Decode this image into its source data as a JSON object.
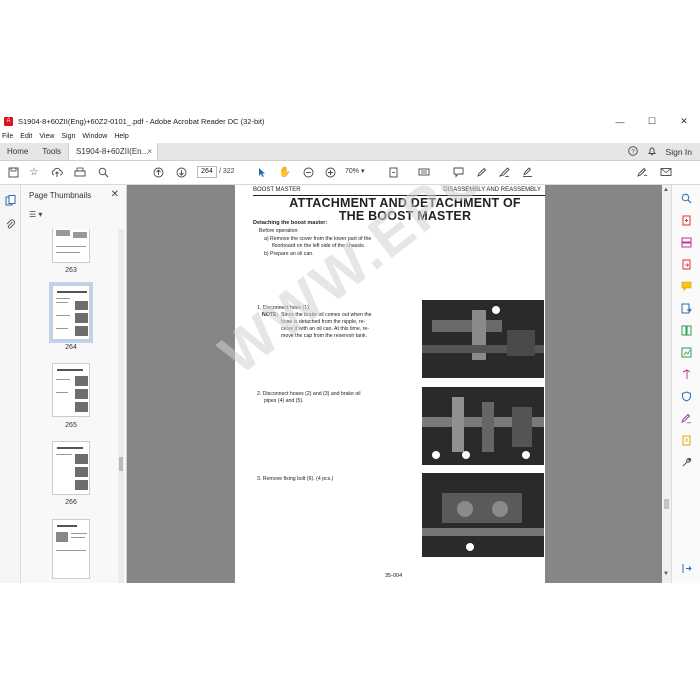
{
  "window": {
    "title": "S1904-8+60ZII(Eng)+60Z2-0101_.pdf - Adobe Acrobat Reader DC (32-bit)",
    "controls": [
      "—",
      "☐",
      "✕"
    ]
  },
  "menu": [
    "File",
    "Edit",
    "View",
    "Sign",
    "Window",
    "Help"
  ],
  "tabs": {
    "home": "Home",
    "tools": "Tools",
    "document": "S1904-8+60ZII(En...",
    "close": "×",
    "sign_in": "Sign In"
  },
  "toolbar": {
    "current_page": "264",
    "total_pages": "/ 322",
    "zoom": "70%"
  },
  "thumbnails": {
    "header": "Page Thumbnails",
    "pages": [
      "263",
      "264",
      "265",
      "266"
    ],
    "selected": "264"
  },
  "document": {
    "header_left": "BOOST MASTER",
    "header_right": "DISASSEMBLY AND REASSEMBLY",
    "title_line1": "ATTACHMENT AND DETACHMENT OF",
    "title_line2": "THE BOOST MASTER",
    "subtitle": "Detaching the boost master:",
    "before_operation": "Before operation:",
    "step_a": "a)  Remove the cover from the lower part of the",
    "step_a2": "floorboard on the left side of the chassis.",
    "step_b": "b)  Prepare an oil can.",
    "step1": "1. Disconnect hose (1).",
    "note_label": "NOTE:",
    "note1": "Since the brake oil comes out when the",
    "note2": "hose is detached from the nipple, re-",
    "note3": "ceive it with an oil can. At this time, re-",
    "note4": "move the cap from the reservoir tank.",
    "step2a": "2. Disconnect  hoses  (2)  and  (3)  and  brake  oil",
    "step2b": "pipes (4) and (5).",
    "step3": "3. Remove fixing bolt (6). (4 pcs.)",
    "page_number": "35-004",
    "watermark": "WWW.EPCDEPO.COM"
  },
  "colors": {
    "accent": "#2b6cb0",
    "doc_bg": "#868686",
    "selection": "#bcd4ee"
  }
}
